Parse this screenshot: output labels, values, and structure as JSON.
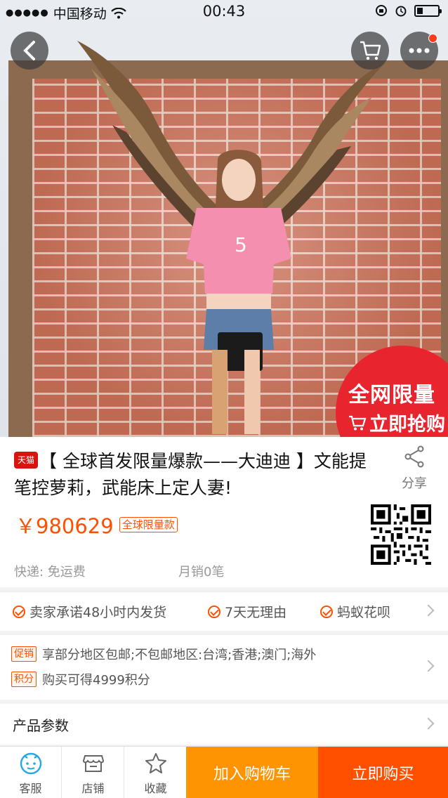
{
  "status_bar": {
    "signal": "●●●●●",
    "carrier": "中国移动",
    "time": "00:43"
  },
  "hero": {
    "badge_line1": "全网限量",
    "badge_line2": "立即抢购"
  },
  "product": {
    "platform_tag": "天猫",
    "title": "【 全球首发限量爆款——大迪迪 】文能提笔控萝莉，武能床上定人妻!",
    "share_label": "分享",
    "price": "￥980629",
    "price_tag": "全球限量款",
    "shipping": "快递: 免运费",
    "monthly_sales": "月销0笔"
  },
  "guarantees": [
    {
      "label": "卖家承诺48小时内发货"
    },
    {
      "label": "7天无理由"
    },
    {
      "label": "蚂蚁花呗"
    }
  ],
  "promotions": [
    {
      "tag": "促销",
      "text": "享部分地区包邮;不包邮地区:台湾;香港;澳门;海外"
    },
    {
      "tag": "积分",
      "text": "购买可得4999积分"
    }
  ],
  "params_label": "产品参数",
  "bottom_bar": {
    "service": "客服",
    "shop": "店铺",
    "favorite": "收藏",
    "add_to_cart": "加入购物车",
    "buy_now": "立即购买"
  },
  "colors": {
    "accent": "#ff5000",
    "cart_button": "#ff9402",
    "badge_red": "#e8242f",
    "tmall_red": "#d7150e"
  }
}
